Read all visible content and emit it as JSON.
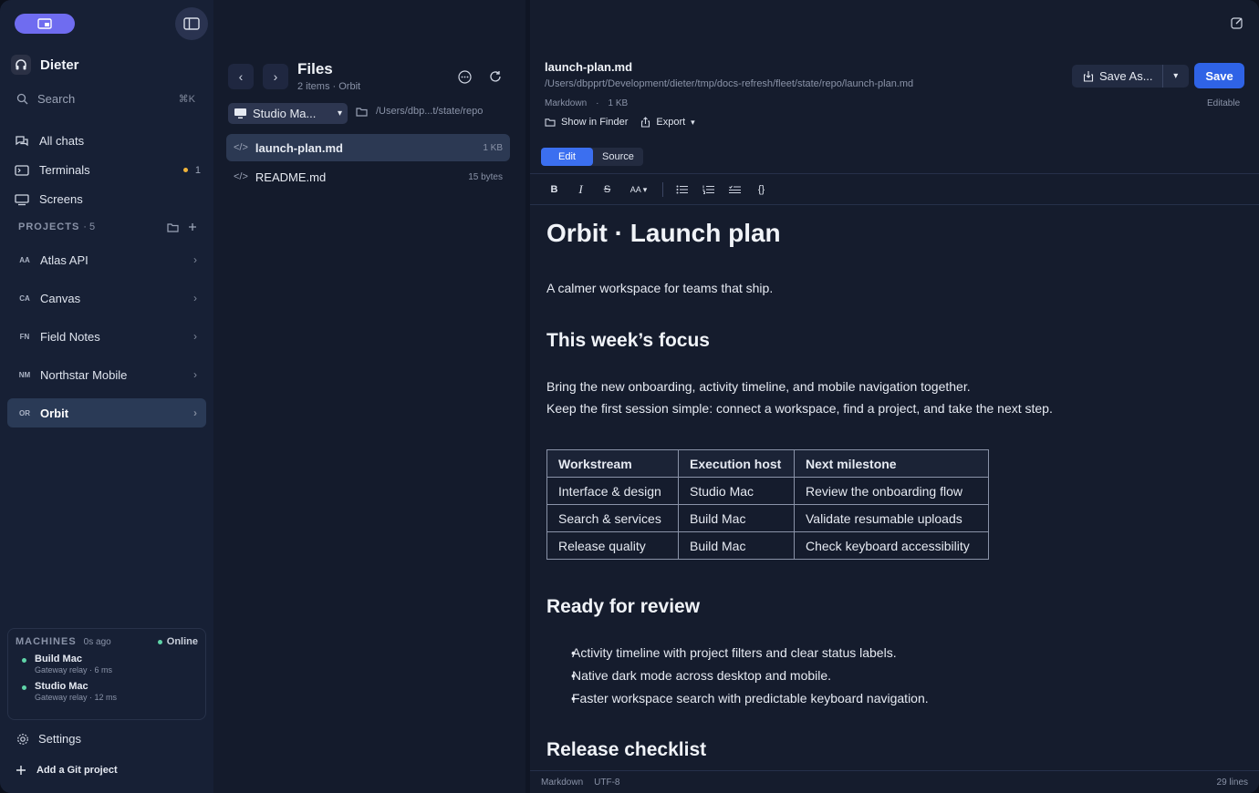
{
  "sidebar": {
    "user_name": "Dieter",
    "search": {
      "placeholder": "Search",
      "shortcut": "⌘K"
    },
    "nav": [
      {
        "label": "All chats",
        "icon": "chats-icon"
      },
      {
        "label": "Terminals",
        "icon": "terminal-icon",
        "count": "1"
      },
      {
        "label": "Screens",
        "icon": "screens-icon"
      }
    ],
    "projects_header": "PROJECTS",
    "projects_count": "· 5",
    "projects": [
      {
        "code": "AA",
        "name": "Atlas API"
      },
      {
        "code": "CA",
        "name": "Canvas"
      },
      {
        "code": "FN",
        "name": "Field Notes"
      },
      {
        "code": "NM",
        "name": "Northstar Mobile"
      },
      {
        "code": "OR",
        "name": "Orbit"
      }
    ],
    "machines": {
      "header": "MACHINES",
      "ago": "0s ago",
      "status": "Online",
      "items": [
        {
          "name": "Build Mac",
          "sub": "Gateway relay · 6 ms"
        },
        {
          "name": "Studio Mac",
          "sub": "Gateway relay · 12 ms"
        }
      ]
    },
    "settings_label": "Settings",
    "add_git_label": "Add a Git project"
  },
  "files": {
    "title": "Files",
    "subtitle": "2 items · Orbit",
    "host": "Studio Ma...",
    "path": "/Users/dbp...t/state/repo",
    "items": [
      {
        "name": "launch-plan.md",
        "size": "1 KB"
      },
      {
        "name": "README.md",
        "size": "15 bytes"
      }
    ]
  },
  "editor": {
    "file_name": "launch-plan.md",
    "file_path": "/Users/dbpprt/Development/dieter/tmp/docs-refresh/fleet/state/repo/launch-plan.md",
    "file_type": "Markdown",
    "file_size": "1 KB",
    "show_in_finder": "Show in Finder",
    "export": "Export",
    "save_as": "Save As...",
    "save": "Save",
    "editable": "Editable",
    "mode_edit": "Edit",
    "mode_source": "Source",
    "toolbar": {
      "bold": "B",
      "italic": "I",
      "strike": "S",
      "size": "AA",
      "code": "{}"
    },
    "doc": {
      "h1": "Orbit · Launch plan",
      "tagline": "A calmer workspace for teams that ship.",
      "h2_focus": "This week’s focus",
      "focus_p1": "Bring the new onboarding, activity timeline, and mobile navigation together.",
      "focus_p2": "Keep the first session simple: connect a workspace, find a project, and take the next step.",
      "table": {
        "headers": [
          "Workstream",
          "Execution host",
          "Next milestone"
        ],
        "rows": [
          [
            "Interface & design",
            "Studio Mac",
            "Review the onboarding flow"
          ],
          [
            "Search & services",
            "Build Mac",
            "Validate resumable uploads"
          ],
          [
            "Release quality",
            "Build Mac",
            "Check keyboard accessibility"
          ]
        ]
      },
      "h2_review": "Ready for review",
      "review_items": [
        "Activity timeline with project filters and clear status labels.",
        "Native dark mode across desktop and mobile.",
        "Faster workspace search with predictable keyboard navigation."
      ],
      "h2_checklist": "Release checklist"
    },
    "status": {
      "lang": "Markdown",
      "encoding": "UTF-8",
      "lines": "29 lines"
    }
  },
  "colors": {
    "accent": "#2f63e6",
    "online": "#5fd4a8",
    "warning": "#f0b33a",
    "toggle": "#6f6cf0"
  }
}
